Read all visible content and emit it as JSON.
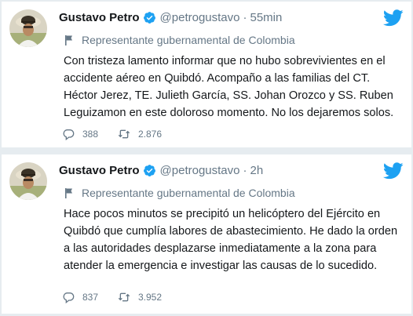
{
  "tweets": [
    {
      "display_name": "Gustavo Petro",
      "handle": "@petrogustavo",
      "separator": "·",
      "time": "55min",
      "label": "Representante gubernamental de Colombia",
      "text": "Con tristeza lamento informar que no hubo sobrevivientes en el accidente aéreo en Quibdó. Acompaño a las familias del CT. Héctor Jerez, TE. Julieth García, SS. Johan Orozco y SS. Ruben Leguizamon en este doloroso momento. No los dejaremos solos.",
      "replies": "388",
      "retweets": "2.876"
    },
    {
      "display_name": "Gustavo Petro",
      "handle": "@petrogustavo",
      "separator": "·",
      "time": "2h",
      "label": "Representante gubernamental de Colombia",
      "text": "Hace pocos minutos se precipitó un helicóptero del Ejército en Quibdó que cumplía labores de abastecimiento. He dado la orden a las autoridades desplazarse inmediatamente a la zona para atender la emergencia e investigar las causas de lo sucedido.",
      "replies": "837",
      "retweets": "3.952"
    }
  ],
  "colors": {
    "twitter_blue": "#1da1f2",
    "secondary_text": "#657786",
    "primary_text": "#14171a",
    "divider": "#e6ecf0"
  },
  "icons": {
    "verified": "verified-badge-icon",
    "platform": "twitter-bird-icon",
    "label": "flag-icon",
    "reply": "reply-icon",
    "retweet": "retweet-icon"
  }
}
